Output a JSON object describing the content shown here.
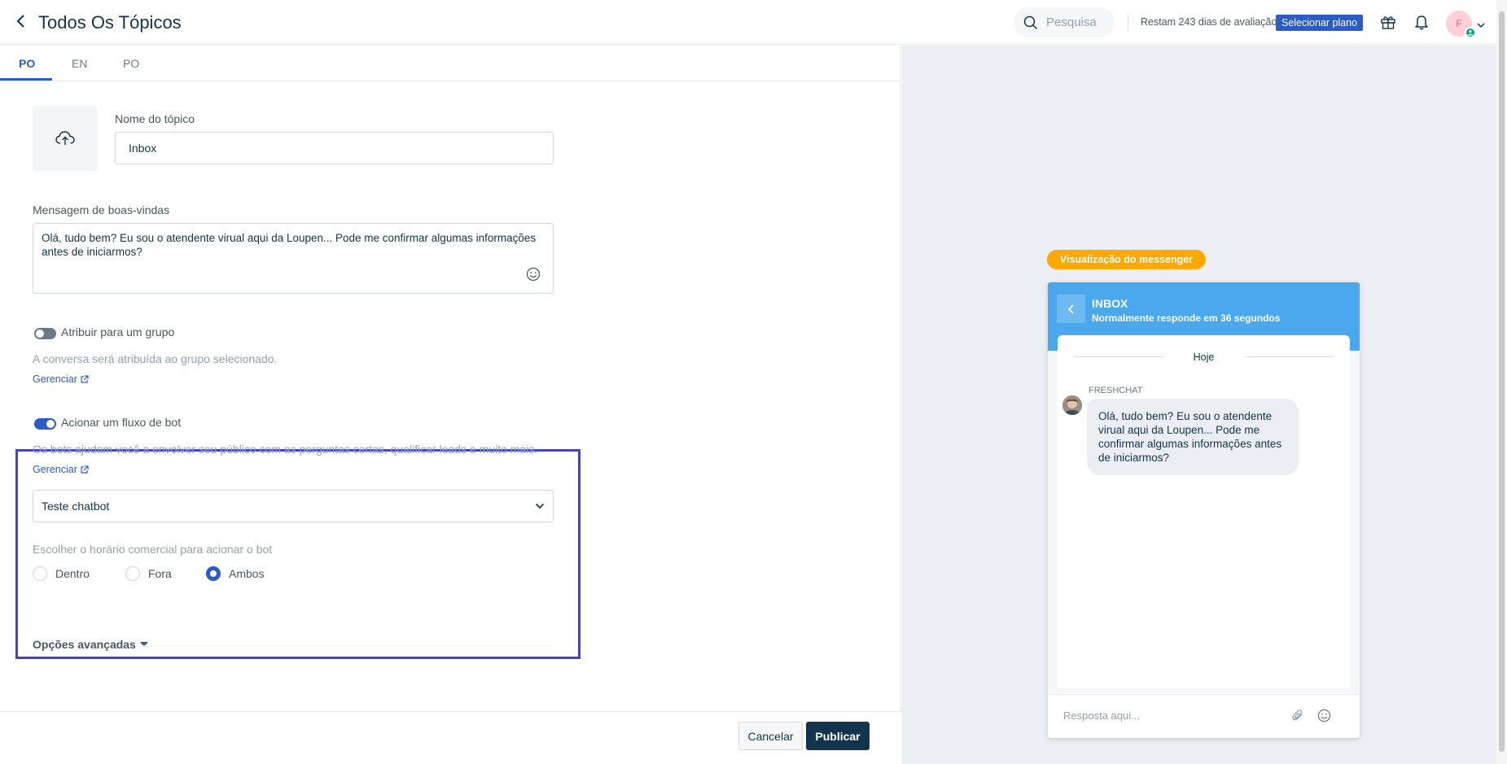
{
  "header": {
    "title": "Todos Os Tópicos",
    "search_placeholder": "Pesquisa",
    "trial_text": "Restam 243 dias de avaliação",
    "select_plan_label": "Selecionar plano",
    "avatar_initial": "F"
  },
  "tabs": [
    {
      "label": "PO",
      "active": true
    },
    {
      "label": "EN",
      "active": false
    },
    {
      "label": "PO",
      "active": false
    }
  ],
  "form": {
    "topic_name_label": "Nome do tópico",
    "topic_name_value": "Inbox",
    "welcome_label": "Mensagem de boas-vindas",
    "welcome_value": "Olá, tudo bem? Eu sou o atendente virual aqui da Loupen... Pode me confirmar algumas informações antes de iniciarmos?",
    "assign_group": {
      "label": "Atribuir para um grupo",
      "enabled": false,
      "helper": "A conversa será atribuída ao grupo selecionado.",
      "manage_label": "Gerenciar"
    },
    "bot_flow": {
      "label": "Acionar um fluxo de bot",
      "enabled": true,
      "helper": "Os bots ajudam você a envolver seu público com as perguntas certas, qualificar leads e muito mais.",
      "manage_label": "Gerenciar",
      "selected_bot": "Teste chatbot",
      "hours_label": "Escolher o horário comercial para acionar o bot",
      "radio_options": [
        {
          "label": "Dentro",
          "checked": false
        },
        {
          "label": "Fora",
          "checked": false
        },
        {
          "label": "Ambos",
          "checked": true
        }
      ]
    },
    "advanced_label": "Opções avançadas"
  },
  "footer": {
    "cancel_label": "Cancelar",
    "publish_label": "Publicar"
  },
  "preview": {
    "badge": "Visualização do messenger",
    "title": "INBOX",
    "subtitle": "Normalmente responde em 36 segundos",
    "date": "Hoje",
    "sender": "FRESHCHAT",
    "message": "Olá, tudo bem? Eu sou o atendente virual aqui da Loupen... Pode me confirmar algumas informações antes de iniciarmos?",
    "reply_placeholder": "Resposta aqui..."
  },
  "colors": {
    "accent": "#2c5cc5",
    "highlight_border": "#4545c4",
    "messenger_header": "#4aa8ec",
    "preview_badge": "#ffa800",
    "publish_button": "#12344d"
  }
}
